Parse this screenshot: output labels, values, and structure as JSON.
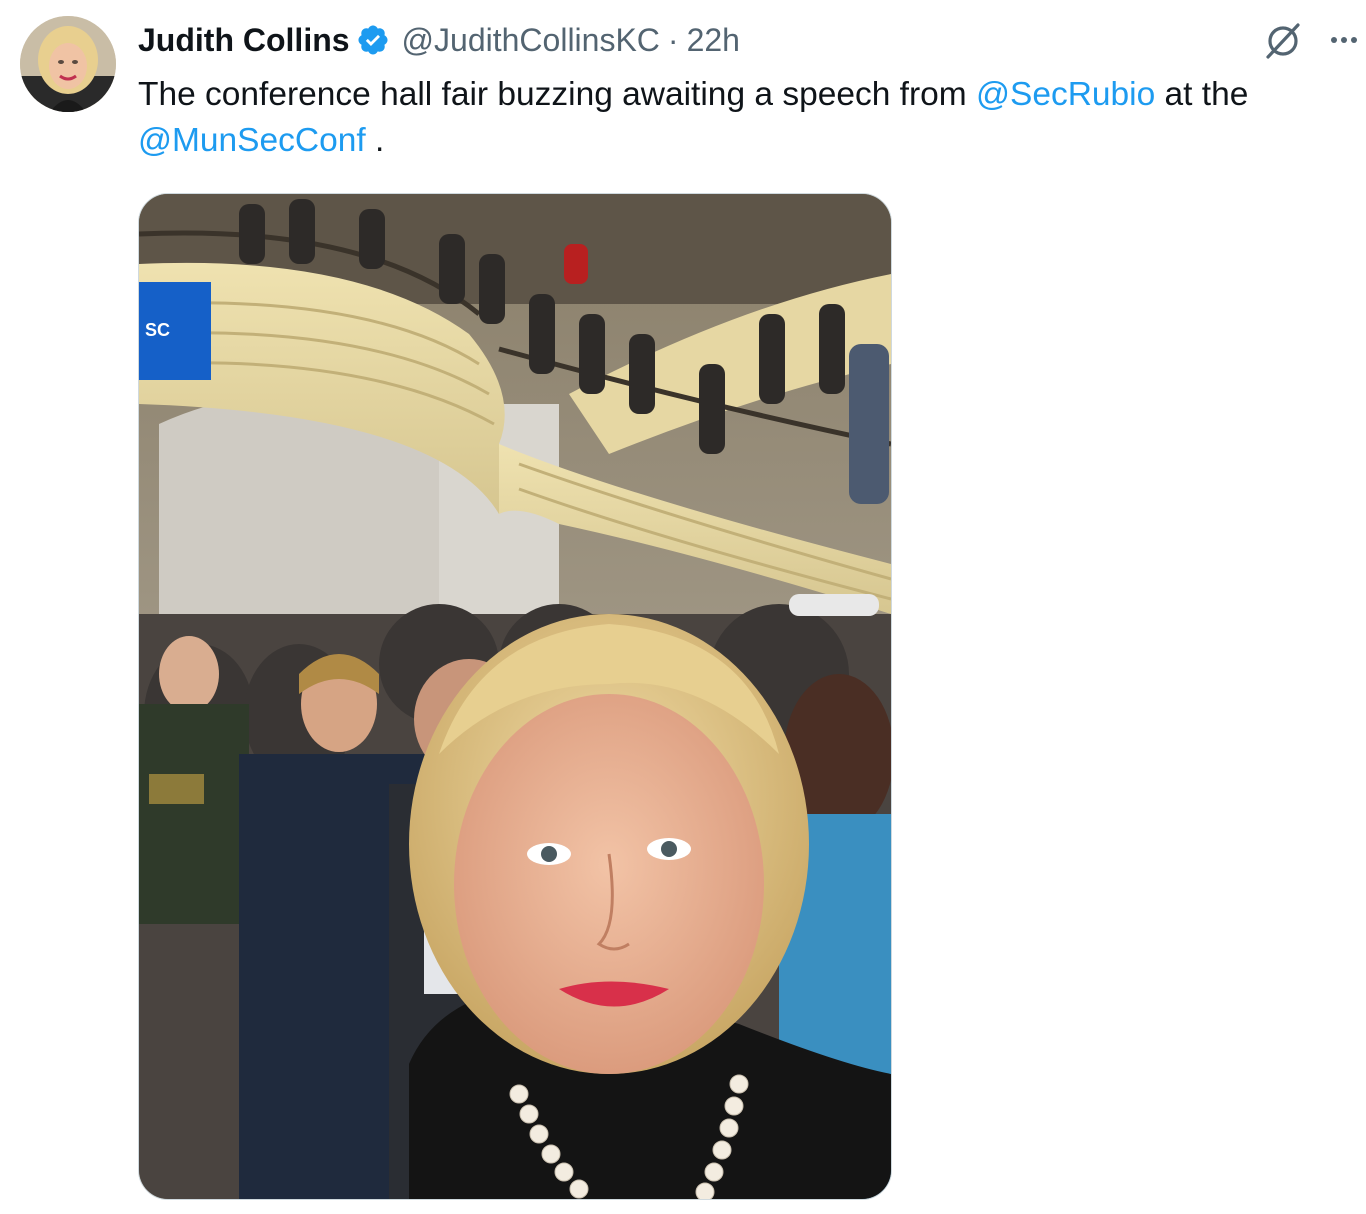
{
  "author": {
    "name": "Judith Collins",
    "handle": "@JudithCollinsKC",
    "separator": "·",
    "time": "22h",
    "verified": true,
    "avatar_icon": "profile-photo"
  },
  "tweet": {
    "text_part1": "The conference hall fair buzzing awaiting a speech from ",
    "mention1": "@SecRubio",
    "text_part2": " at the ",
    "mention2": "@MunSecConf",
    "text_part3": " ."
  },
  "media": {
    "screen_text": "SC"
  },
  "icons": {
    "verified": "verified-badge-icon",
    "grok": "grok-icon",
    "more": "more-options-icon"
  },
  "colors": {
    "link": "#1d9bf0",
    "text": "#0f1419",
    "secondary": "#536471",
    "border": "#cfd9de"
  }
}
